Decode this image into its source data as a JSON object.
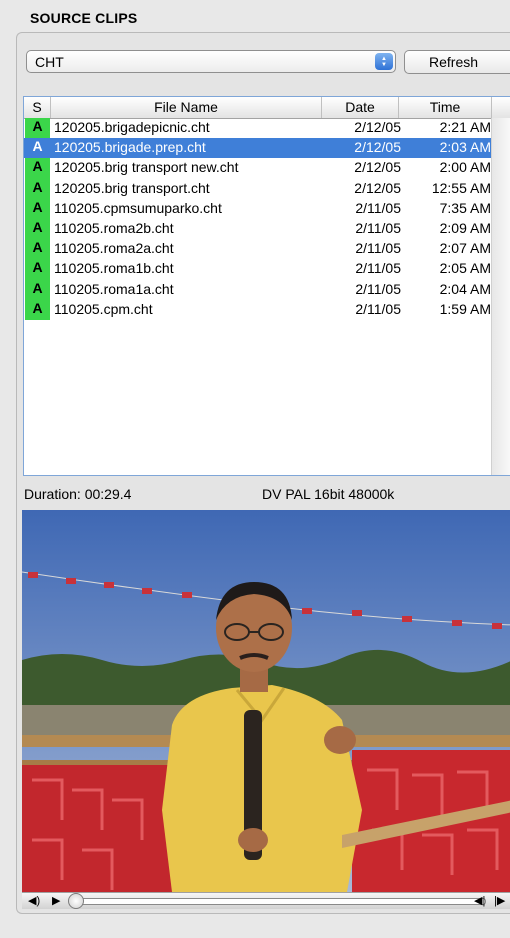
{
  "panel": {
    "title": "SOURCE CLIPS"
  },
  "source_popup": {
    "value": "CHT"
  },
  "refresh_button": {
    "label": "Refresh"
  },
  "table": {
    "columns": {
      "status": "S",
      "file_name": "File Name",
      "date": "Date",
      "time": "Time"
    },
    "rows": [
      {
        "status": "A",
        "file_name": "120205.brigadepicnic.cht",
        "date": "2/12/05",
        "time": "2:21 AM",
        "selected": false
      },
      {
        "status": "A",
        "file_name": "120205.brigade.prep.cht",
        "date": "2/12/05",
        "time": "2:03 AM",
        "selected": true
      },
      {
        "status": "A",
        "file_name": "120205.brig transport new.cht",
        "date": "2/12/05",
        "time": "2:00 AM",
        "selected": false
      },
      {
        "status": "A",
        "file_name": "120205.brig transport.cht",
        "date": "2/12/05",
        "time": "12:55 AM",
        "selected": false
      },
      {
        "status": "A",
        "file_name": "110205.cpmsumuparko.cht",
        "date": "2/11/05",
        "time": "7:35 AM",
        "selected": false
      },
      {
        "status": "A",
        "file_name": "110205.roma2b.cht",
        "date": "2/11/05",
        "time": "2:09 AM",
        "selected": false
      },
      {
        "status": "A",
        "file_name": "110205.roma2a.cht",
        "date": "2/11/05",
        "time": "2:07 AM",
        "selected": false
      },
      {
        "status": "A",
        "file_name": "110205.roma1b.cht",
        "date": "2/11/05",
        "time": "2:05 AM",
        "selected": false
      },
      {
        "status": "A",
        "file_name": "110205.roma1a.cht",
        "date": "2/11/05",
        "time": "2:04 AM",
        "selected": false
      },
      {
        "status": "A",
        "file_name": "110205.cpm.cht",
        "date": "2/11/05",
        "time": "1:59 AM",
        "selected": false
      }
    ]
  },
  "clip_info": {
    "duration": "Duration: 00:29.4",
    "format": "DV PAL 16bit 48000k"
  },
  "player": {
    "volume_icon": "speaker-icon",
    "play_icon": "play-icon",
    "step_back_icon": "step-back-icon",
    "step_forward_icon": "step-forward-icon",
    "position_fraction": 0.0
  },
  "colors": {
    "selection": "#3f7fd8",
    "status_ok": "#3bd64a"
  }
}
